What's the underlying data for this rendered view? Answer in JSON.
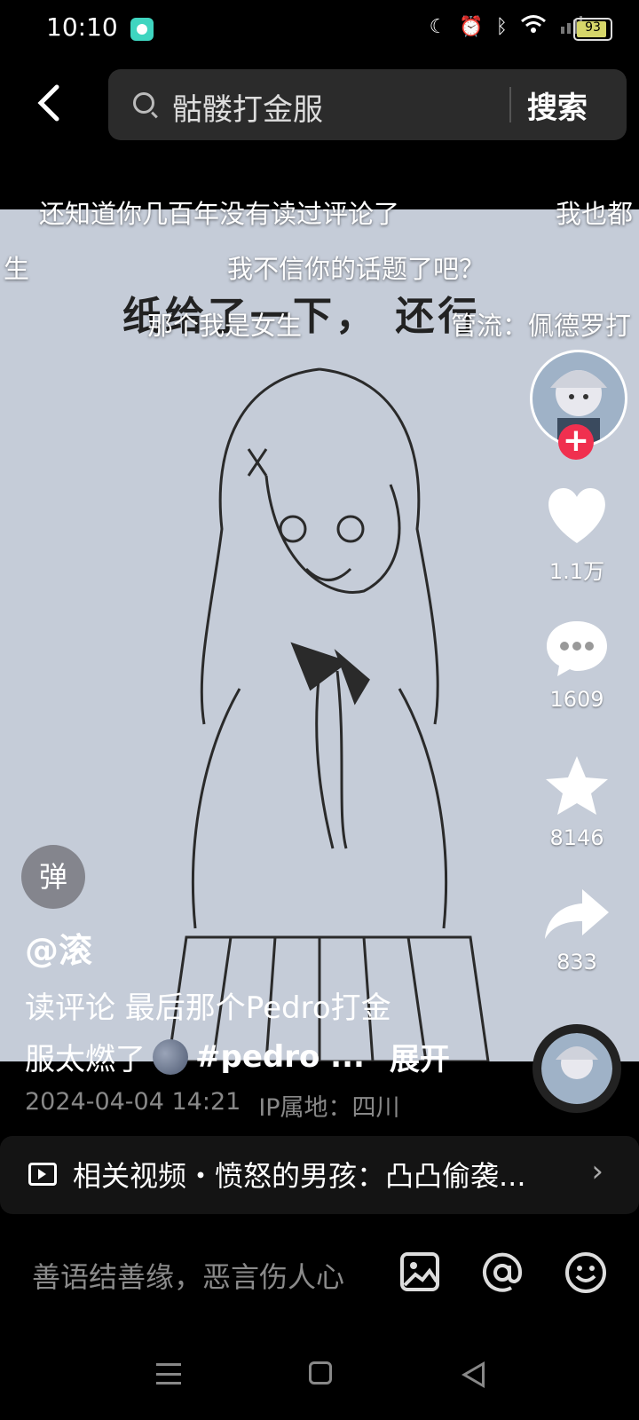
{
  "status_bar": {
    "time": "10:10",
    "battery": "93"
  },
  "search": {
    "query": "骷髅打金服",
    "button": "搜索"
  },
  "video": {
    "handwritten_title": "纸给了一下， 还行",
    "danmaku": [
      "还知道你几百年没有读过评论了",
      "我也都",
      "生",
      "我不信你的话题了吧？",
      "那个我是女生",
      "管流：佩德罗打"
    ]
  },
  "actions": {
    "like_count": "1.1万",
    "comment_count": "1609",
    "favorite_count": "8146",
    "share_count": "833"
  },
  "post": {
    "danmaku_toggle": "弹",
    "author": "@滚",
    "desc_line1": "读评论 最后那个Pedro打金",
    "desc_line2": "服太燃了",
    "hashtag": "#pedro ...",
    "expand": "展开",
    "date": "2024-04-04 14:21",
    "ip": "IP属地：四川"
  },
  "related": {
    "text": "相关视频・愤怒的男孩：凸凸偷袭..."
  },
  "comment": {
    "placeholder": "善语结善缘，恶言伤人心"
  },
  "icons": [
    "back-icon",
    "search-icon",
    "follow-plus-icon",
    "heart-icon",
    "comment-icon",
    "star-icon",
    "share-icon",
    "music-disc-icon",
    "moon-emoji-icon",
    "related-video-icon",
    "chevron-right-icon",
    "image-icon",
    "at-icon",
    "emoji-icon",
    "nav-menu-icon",
    "nav-home-icon",
    "nav-back-icon"
  ],
  "colors": {
    "follow": "#f0304f",
    "background": "#000000",
    "video_bg": "#c5ccd8"
  }
}
